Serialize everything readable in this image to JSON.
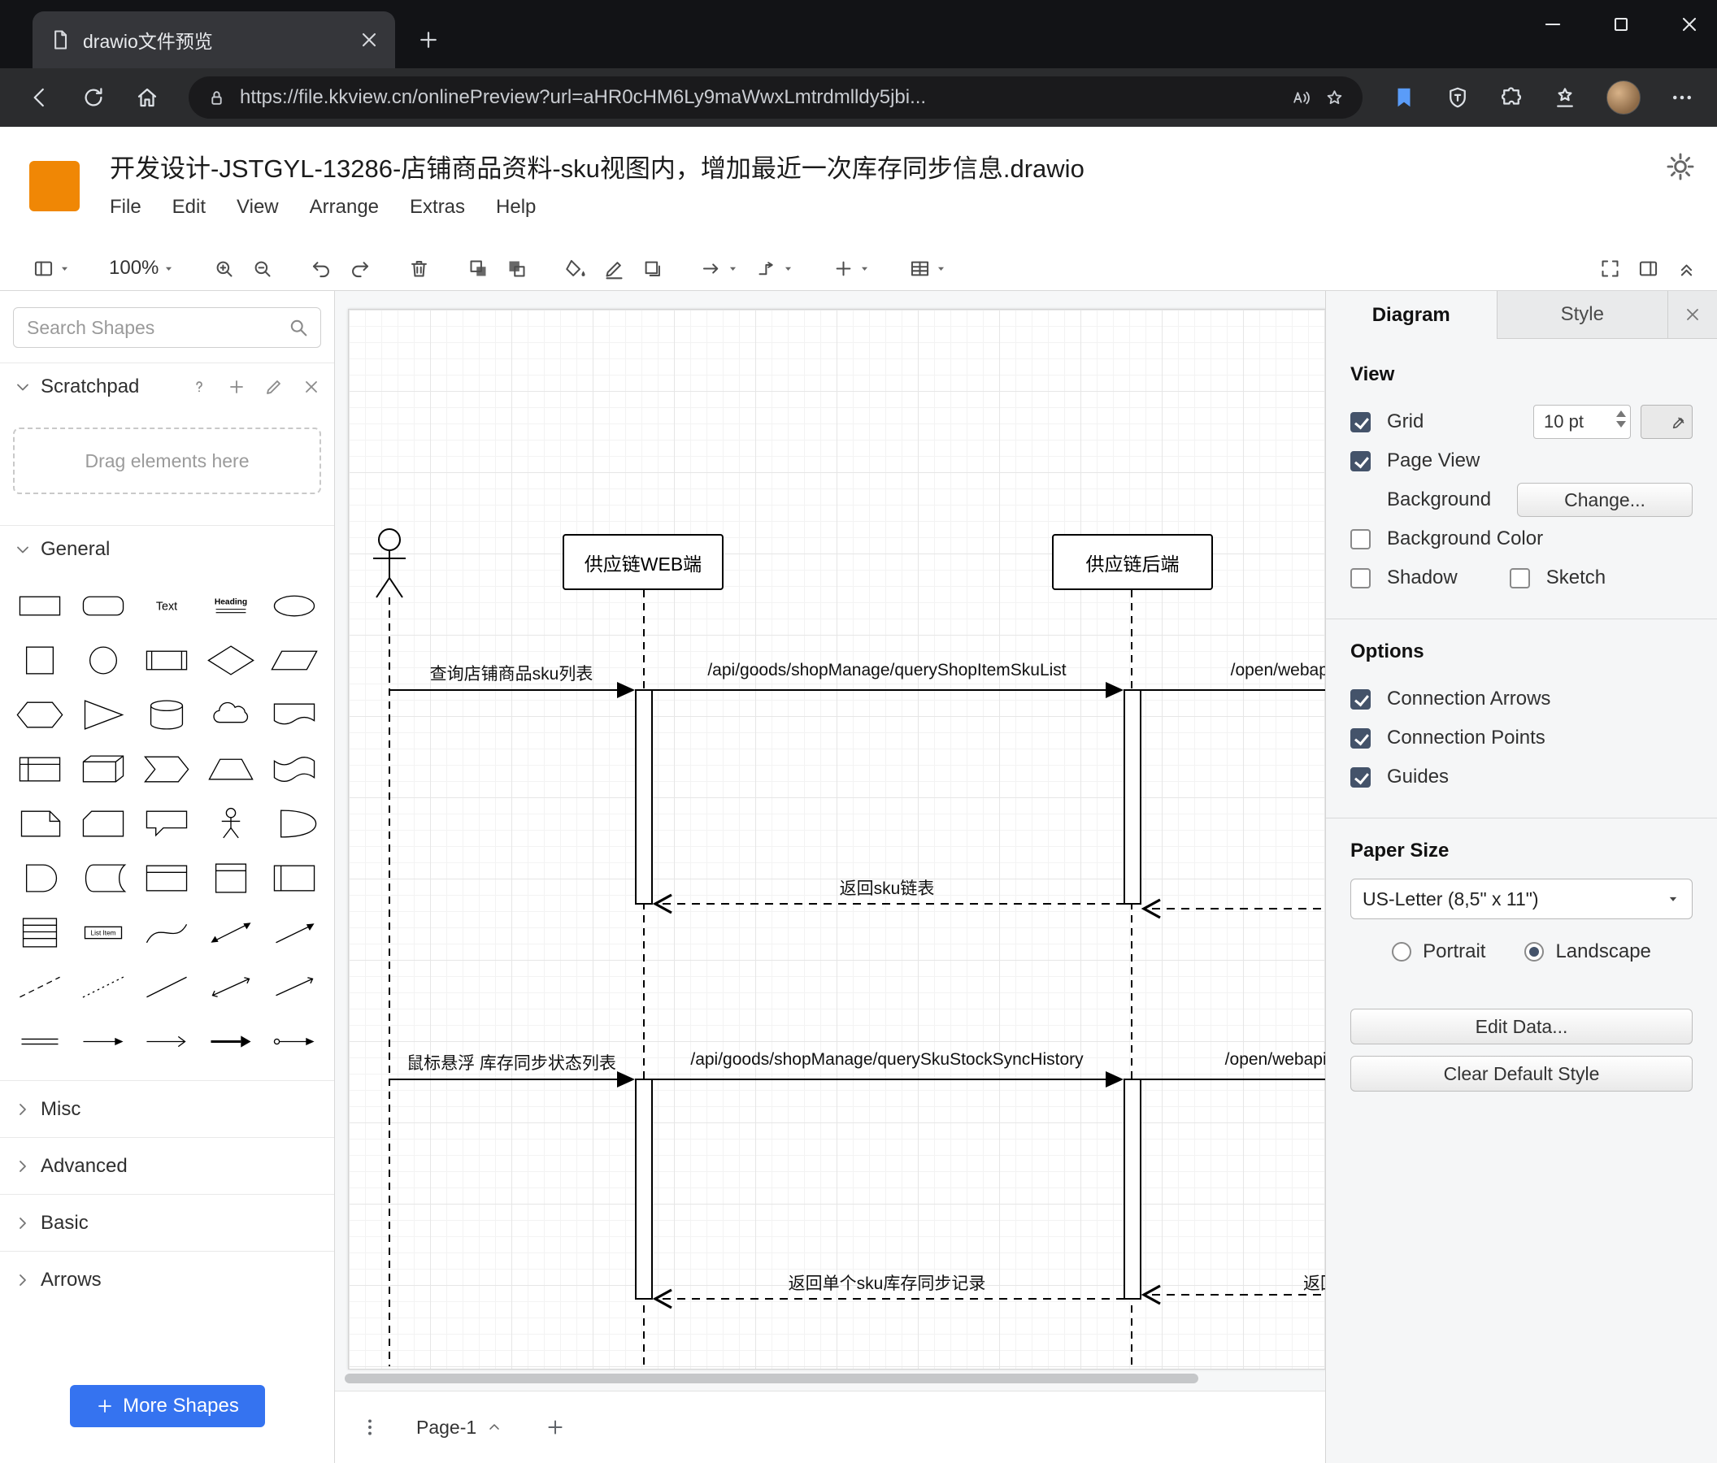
{
  "browser": {
    "tab_title": "drawio文件预览",
    "url": "https://file.kkview.cn/onlinePreview?url=aHR0cHM6Ly9maWwxLmtrdmlldy5jbi..."
  },
  "header": {
    "title": "开发设计-JSTGYL-13286-店铺商品资料-sku视图内，增加最近一次库存同步信息.drawio",
    "menus": [
      "File",
      "Edit",
      "View",
      "Arrange",
      "Extras",
      "Help"
    ]
  },
  "toolbar": {
    "zoom": "100%"
  },
  "sidebar": {
    "search_placeholder": "Search Shapes",
    "scratchpad": {
      "title": "Scratchpad",
      "hint": "Drag elements here"
    },
    "sections": [
      "General",
      "Misc",
      "Advanced",
      "Basic",
      "Arrows"
    ],
    "more_shapes": "More Shapes",
    "palette_labels": {
      "text": "Text",
      "heading": "Heading",
      "list": "List",
      "list_item": "List Item"
    },
    "palette": [
      "rectangle",
      "rounded-rectangle",
      "text",
      "heading",
      "ellipse",
      "square",
      "circle",
      "process",
      "diamond",
      "parallelogram",
      "hexagon",
      "triangle",
      "cylinder",
      "cloud",
      "document",
      "internal-storage",
      "cube",
      "step",
      "trapezoid",
      "tape",
      "note",
      "card",
      "callout",
      "actor",
      "or",
      "and",
      "data-storage",
      "container",
      "vertical-container",
      "horizontal-container",
      "list",
      "list-item",
      "curve",
      "bidirectional-arrow",
      "arrow",
      "dashed-line",
      "dotted-line",
      "line",
      "bidirectional-connector",
      "directional-connector",
      "link",
      "arrow-simple",
      "arrow-open",
      "arrow-block",
      "connector-symbol"
    ]
  },
  "diagram": {
    "lifelines": [
      {
        "label": "供应链WEB端"
      },
      {
        "label": "供应链后端"
      }
    ],
    "messages": {
      "m1": "查询店铺商品sku列表",
      "m2": "/api/goods/shopManage/queryShopItemSkuList",
      "m3": "/open/webapi/",
      "r1": "返回sku链表",
      "m4": "鼠标悬浮 库存同步状态列表",
      "m5": "/api/goods/shopManage/querySkuStockSyncHistory",
      "m6": "/open/webapi/iten",
      "r2": "返回单个sku库存同步记录",
      "r3": "返回"
    }
  },
  "footer": {
    "page": "Page-1"
  },
  "format": {
    "tabs": {
      "diagram": "Diagram",
      "style": "Style"
    },
    "view": {
      "title": "View",
      "grid": "Grid",
      "grid_size": "10 pt",
      "page_view": "Page View",
      "background": "Background",
      "change": "Change...",
      "background_color": "Background Color",
      "shadow": "Shadow",
      "sketch": "Sketch"
    },
    "options": {
      "title": "Options",
      "connection_arrows": "Connection Arrows",
      "connection_points": "Connection Points",
      "guides": "Guides"
    },
    "paper": {
      "title": "Paper Size",
      "size": "US-Letter (8,5\" x 11\")",
      "portrait": "Portrait",
      "landscape": "Landscape"
    },
    "buttons": {
      "edit_data": "Edit Data...",
      "clear_default_style": "Clear Default Style"
    }
  },
  "colors": {
    "logo_orange": "#f08705",
    "accent_blue": "#3573f0"
  }
}
